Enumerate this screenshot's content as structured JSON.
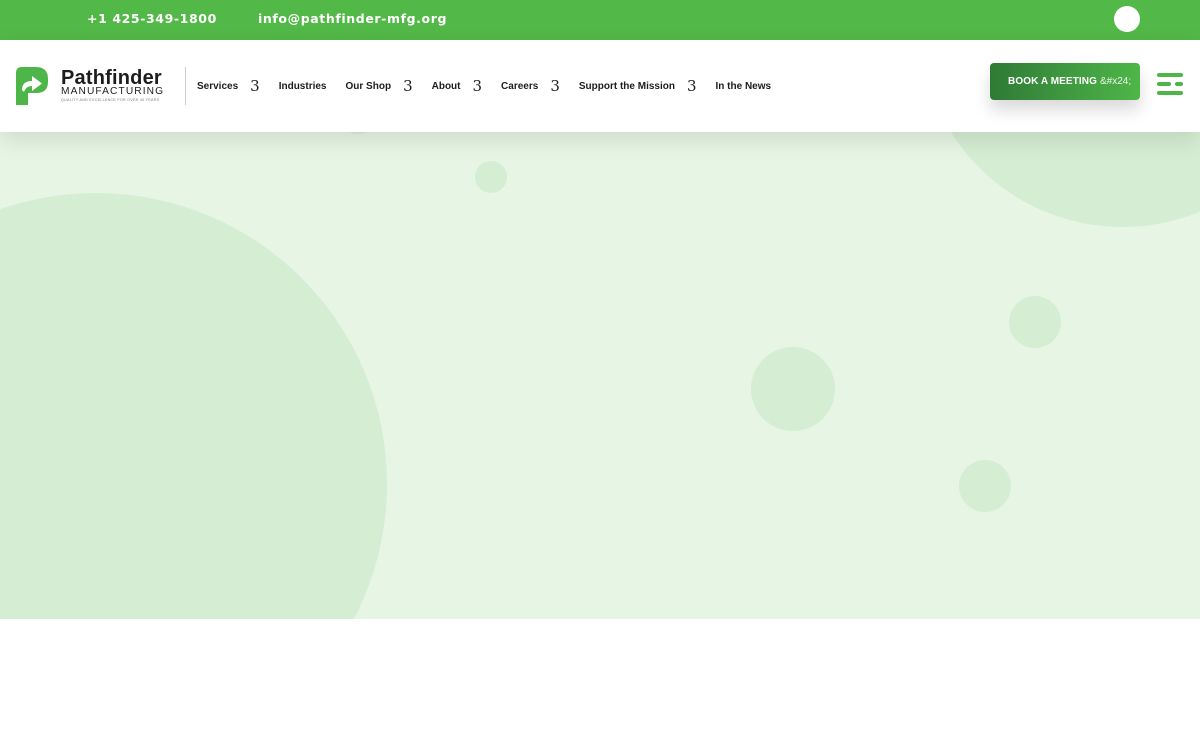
{
  "topbar": {
    "phone": "+1 425-349-1800",
    "email": "info@pathfinder-mfg.org",
    "bg_color": "#52b847"
  },
  "logo": {
    "name": "Pathfinder",
    "subtitle": "MANUFACTURING",
    "tagline": "QUALITY AND EXCELLENCE FOR OVER 40 YEARS",
    "icon": "pathfinder-p-arrow-icon",
    "color": "#4eb648"
  },
  "nav": {
    "items": [
      {
        "label": "Services",
        "dropdown_glyph": "3"
      },
      {
        "label": "Industries"
      },
      {
        "label": "Our Shop",
        "dropdown_glyph": "3"
      },
      {
        "label": "About",
        "dropdown_glyph": "3"
      },
      {
        "label": "Careers",
        "dropdown_glyph": "3"
      },
      {
        "label": "Support the Mission",
        "dropdown_glyph": "3"
      },
      {
        "label": "In the News"
      }
    ]
  },
  "cta": {
    "label": "BOOK A MEETING",
    "icon_text": "&#x24;"
  },
  "menu": {
    "icon": "hamburger-menu-icon"
  },
  "colors": {
    "brand_green": "#4eb648",
    "hero_bg": "#e6f5e4",
    "hero_shapes": "#d5edd3"
  }
}
